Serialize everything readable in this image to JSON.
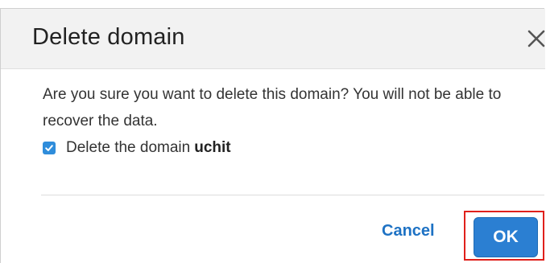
{
  "dialog": {
    "title": "Delete domain",
    "close_icon": "close-icon",
    "message": "Are you sure you want to delete this domain? You will not be able to recover the data.",
    "confirm_checkbox": {
      "checked": true,
      "label_prefix": "Delete the domain",
      "domain_name": "uchit"
    },
    "buttons": {
      "cancel_label": "Cancel",
      "ok_label": "OK"
    }
  },
  "colors": {
    "primary_button": "#2b7fd2",
    "link_text": "#1e72c4",
    "checkbox": "#2f8ddb",
    "highlight_box": "#e0201b",
    "header_background": "#f2f2f2"
  }
}
